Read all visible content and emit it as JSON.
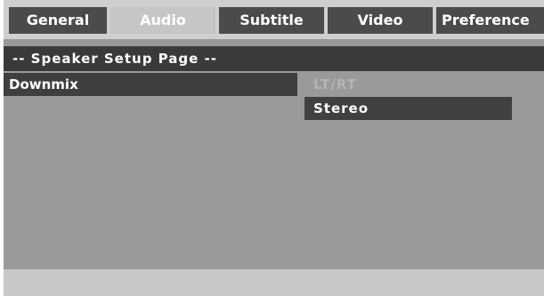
{
  "tabs": [
    {
      "label": "General",
      "active": false
    },
    {
      "label": "Audio",
      "active": true
    },
    {
      "label": "Subtitle",
      "active": false
    },
    {
      "label": "Video",
      "active": false
    },
    {
      "label": "Preference",
      "active": false
    }
  ],
  "page": {
    "header": "-- Speaker Setup Page --"
  },
  "settings": {
    "item": {
      "label": "Downmix"
    },
    "options": [
      {
        "label": "LT/RT",
        "selected": false
      },
      {
        "label": "Stereo",
        "selected": true
      }
    ]
  },
  "colors": {
    "tab_bg": "#4b4b4b",
    "tab_active_bg": "#c6c6c6",
    "panel_bg": "#9a9a9a",
    "highlight_bg": "#404040"
  }
}
